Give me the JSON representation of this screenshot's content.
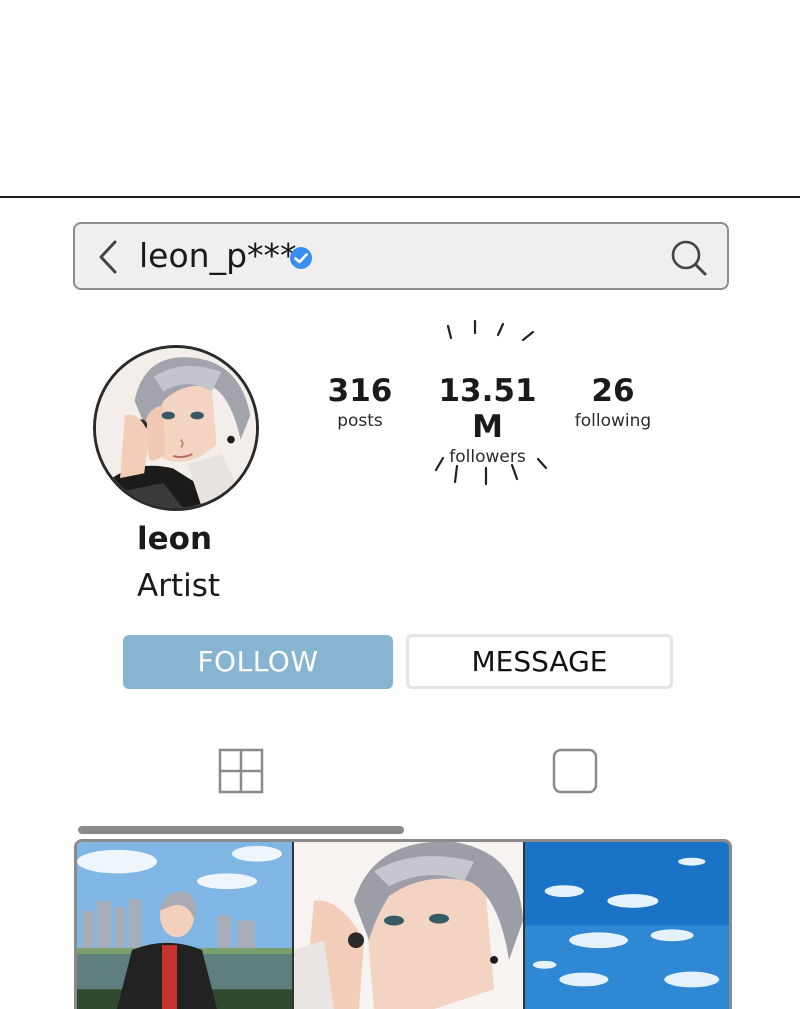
{
  "profile": {
    "handle": "leon_p***",
    "verified": true,
    "name": "leon",
    "bio": "Artist"
  },
  "stats": {
    "posts": {
      "value": "316",
      "label": "posts"
    },
    "followers": {
      "value": "13.51 M",
      "label": "followers"
    },
    "following": {
      "value": "26",
      "label": "following"
    }
  },
  "actions": {
    "follow_label": "FOLLOW",
    "message_label": "MESSAGE"
  },
  "tabs": [
    {
      "name": "grid",
      "icon": "grid-icon",
      "active": true
    },
    {
      "name": "tagged",
      "icon": "square-icon",
      "active": false
    }
  ],
  "posts": [
    {
      "icon": "city-portrait-image"
    },
    {
      "icon": "closeup-portrait-image"
    },
    {
      "icon": "sky-clouds-image"
    }
  ],
  "colors": {
    "follow_button": "#87b4d1",
    "verified_badge": "#3a8ef0",
    "search_bar_bg": "#efefef"
  }
}
